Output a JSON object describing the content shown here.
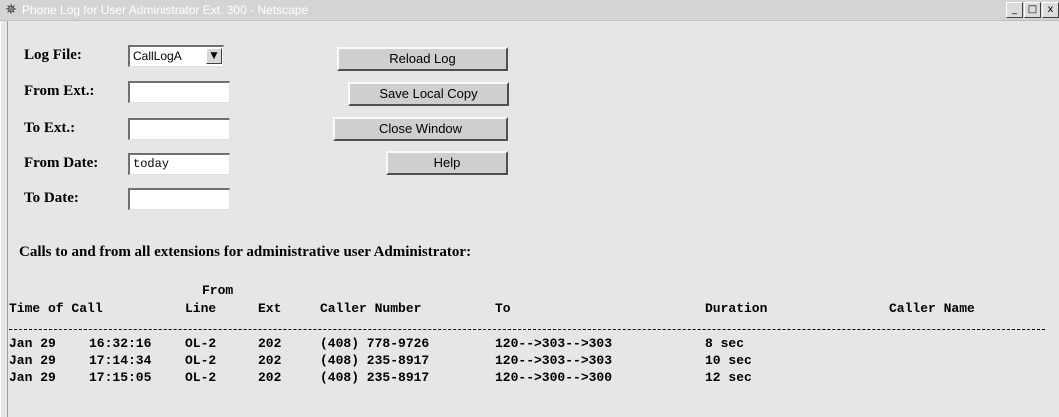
{
  "window": {
    "title": "Phone Log for User Administrator Ext. 300 - Netscape",
    "controls": [
      "_",
      "□",
      "x"
    ]
  },
  "form": {
    "log_file_label": "Log File:",
    "log_file_value": "CallLogA",
    "from_ext_label": "From Ext.:",
    "from_ext_value": "",
    "to_ext_label": "To Ext.:",
    "to_ext_value": "",
    "from_date_label": "From Date:",
    "from_date_value": "today",
    "to_date_label": "To Date:",
    "to_date_value": ""
  },
  "buttons": {
    "reload": "Reload Log",
    "save": "Save Local Copy",
    "close": "Close Window",
    "help": "Help"
  },
  "log": {
    "heading": "Calls to and from all extensions for administrative user Administrator:",
    "from_header": "From",
    "columns": [
      "Time of Call",
      "Line",
      "Ext",
      "Caller Number",
      "To",
      "Duration",
      "Caller Name"
    ],
    "rows": [
      {
        "date": "Jan 29",
        "time": "16:32:16",
        "line": "OL-2",
        "ext": "202",
        "number": "(408) 778-9726",
        "to": "120-->303-->303",
        "duration": "8 sec",
        "name": ""
      },
      {
        "date": "Jan 29",
        "time": "17:14:34",
        "line": "OL-2",
        "ext": "202",
        "number": "(408) 235-8917",
        "to": "120-->303-->303",
        "duration": "10 sec",
        "name": ""
      },
      {
        "date": "Jan 29",
        "time": "17:15:05",
        "line": "OL-2",
        "ext": "202",
        "number": "(408) 235-8917",
        "to": "120-->300-->300",
        "duration": "12 sec",
        "name": ""
      }
    ]
  }
}
